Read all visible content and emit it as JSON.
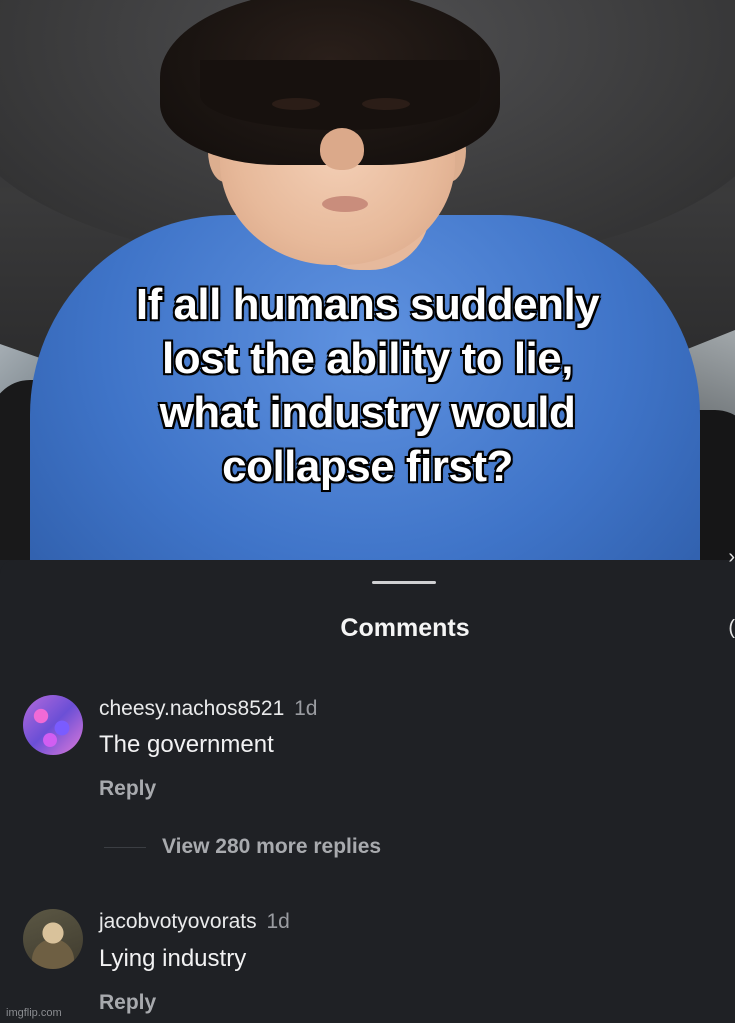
{
  "video": {
    "caption_lines": [
      "If all humans suddenly",
      "lost the ability to lie,",
      "what industry would",
      "collapse first?"
    ]
  },
  "sheet": {
    "title": "Comments"
  },
  "comments": [
    {
      "username": "cheesy.nachos8521",
      "age": "1d",
      "text": "The government",
      "reply_label": "Reply"
    },
    {
      "username": "jacobvotyovorats",
      "age": "1d",
      "text": "Lying industry",
      "reply_label": "Reply"
    }
  ],
  "view_replies_label": "View 280 more replies",
  "watermark": "imgflip.com",
  "colors": {
    "sheet_bg": "#1f2125",
    "shirt": "#3f74c8",
    "muted_text": "#a8aaae"
  }
}
